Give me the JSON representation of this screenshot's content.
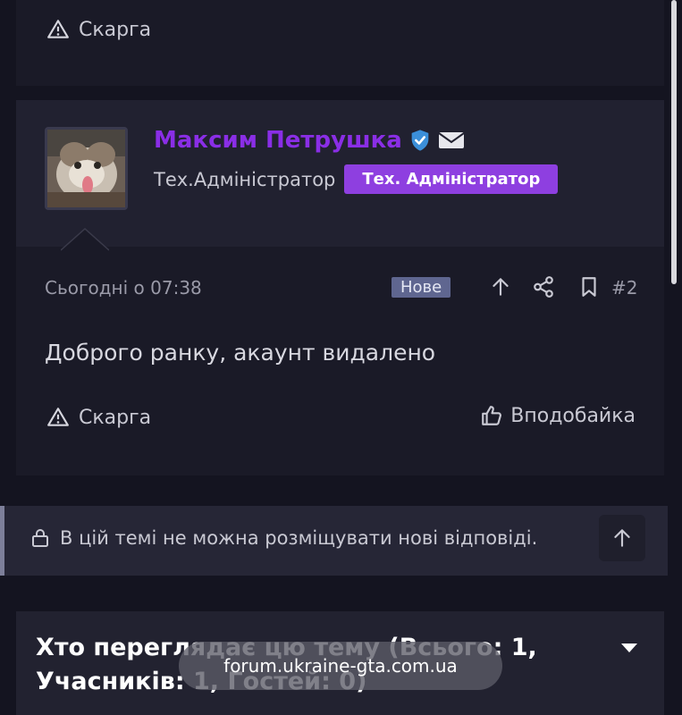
{
  "top_card": {
    "report_label": "Скарга"
  },
  "post": {
    "author_name": "Максим Петрушка",
    "author_role": "Тех.Адміністратор",
    "role_badge": "Тех. Адміністратор",
    "date": "Сьогодні о 07:38",
    "new_badge": "Нове",
    "post_number": "#2",
    "body": "Доброго ранку, акаунт видалено",
    "report_label": "Скарга",
    "like_label": "Вподобайка"
  },
  "locked_notice": {
    "text": "В цій темі не можна розміщувати нові відповіді."
  },
  "viewers": {
    "title_line1": "Хто переглядає цю тему (Всього: 1,",
    "title_line2": "Учасників: 1, Гостей: 0)"
  },
  "browser": {
    "url": "forum.ukraine-gta.com.ua"
  },
  "colors": {
    "username": "#8a2ee6",
    "role_badge": "#8e3fe0",
    "new_badge": "#5f6690",
    "verified": "#3b8fd9",
    "background": "#141420"
  },
  "icons": {
    "report": "warning-triangle-icon",
    "verified": "verified-shield-icon",
    "message": "envelope-icon",
    "share_up": "arrow-up-icon",
    "share": "share-icon",
    "bookmark": "bookmark-icon",
    "like": "thumbs-up-icon",
    "lock": "lock-icon",
    "scroll_top": "arrow-up-icon",
    "toggle": "caret-down-icon"
  }
}
